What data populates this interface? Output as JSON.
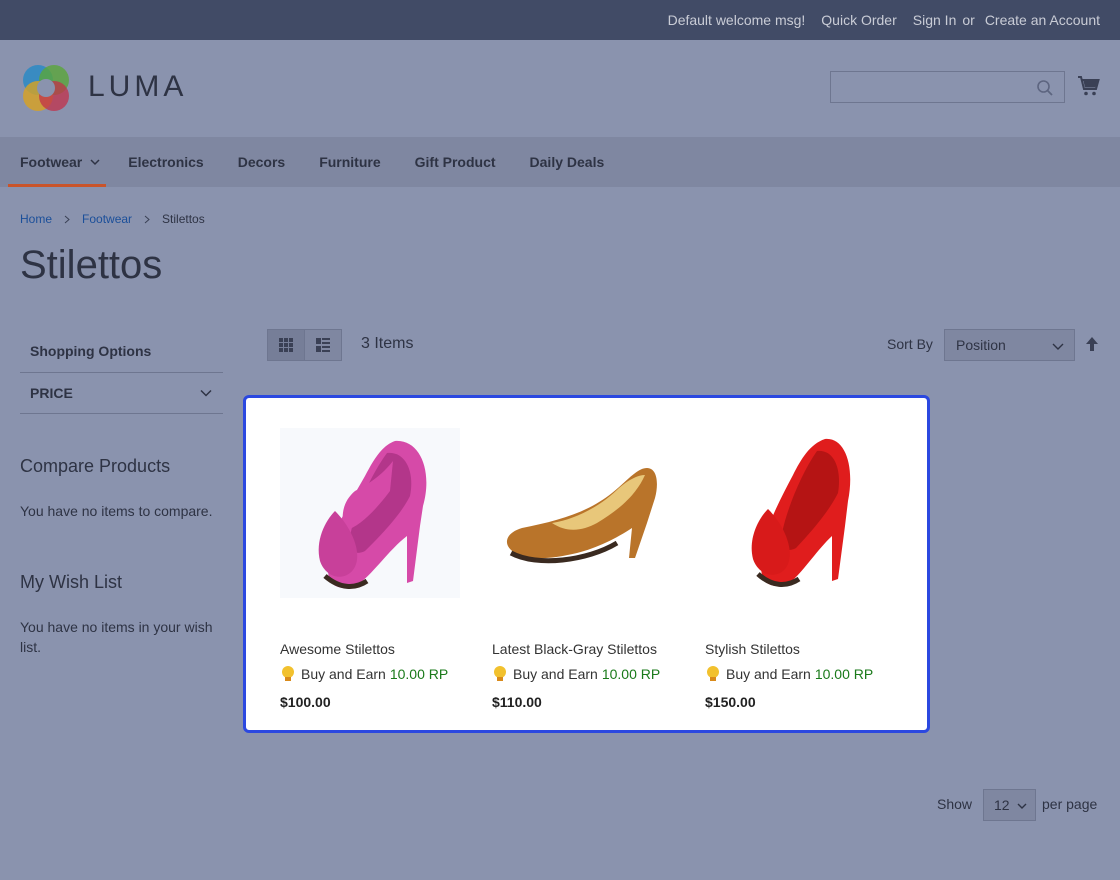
{
  "topbar": {
    "welcome": "Default welcome msg!",
    "quick_order": "Quick Order",
    "sign_in": "Sign In",
    "or": "or",
    "create_account": "Create an Account"
  },
  "header": {
    "logo_text": "LUMA",
    "search_placeholder": ""
  },
  "nav": {
    "items": [
      "Footwear",
      "Electronics",
      "Decors",
      "Furniture",
      "Gift Product",
      "Daily Deals"
    ]
  },
  "breadcrumb": {
    "home": "Home",
    "category": "Footwear",
    "current": "Stilettos"
  },
  "page_title": "Stilettos",
  "sidebar": {
    "shopping_options": "Shopping Options",
    "price_filter": "PRICE",
    "compare_title": "Compare Products",
    "compare_text": "You have no items to compare.",
    "wishlist_title": "My Wish List",
    "wishlist_text": "You have no items in your wish list."
  },
  "toolbar": {
    "item_count": "3 Items",
    "sort_label": "Sort By",
    "sort_value": "Position",
    "show_label": "Show",
    "limit_value": "12",
    "per_page": "per page"
  },
  "products": [
    {
      "name": "Awesome Stilettos",
      "earn_text": "Buy and Earn",
      "points": "10.00 RP",
      "price": "$100.00",
      "color": "#d64aa8"
    },
    {
      "name": "Latest Black-Gray Stilettos",
      "earn_text": "Buy and Earn",
      "points": "10.00 RP",
      "price": "$110.00",
      "color": "#b9742a"
    },
    {
      "name": "Stylish Stilettos",
      "earn_text": "Buy and Earn",
      "points": "10.00 RP",
      "price": "$150.00",
      "color": "#e01d1d"
    }
  ],
  "colors": {
    "topbar_bg": "#414b66",
    "page_bg": "#8a93ae",
    "nav_active": "#c9542a",
    "panel_border": "#2b48e0",
    "points_green": "#1a7a1a"
  }
}
